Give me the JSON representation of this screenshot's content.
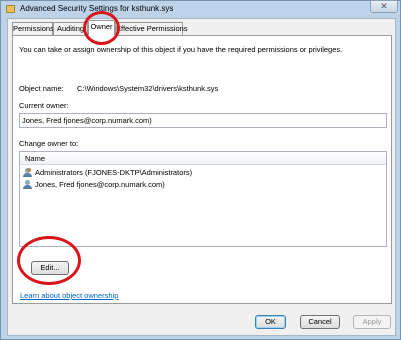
{
  "window": {
    "title": "Advanced Security Settings for ksthunk.sys",
    "close_glyph": "✕"
  },
  "tabs": [
    {
      "label": "Permissions"
    },
    {
      "label": "Auditing"
    },
    {
      "label": "Owner"
    },
    {
      "label": "Effective Permissions"
    }
  ],
  "owner_tab": {
    "intro": "You can take or assign ownership of this object if you have the required permissions or privileges.",
    "object_name_label": "Object name:",
    "object_name_value": "C:\\Windows\\System32\\drivers\\ksthunk.sys",
    "current_owner_label": "Current owner:",
    "current_owner_value": "Jones, Fred fjones@corp.numark.com)",
    "change_owner_label": "Change owner to:",
    "list_header": "Name",
    "owners": [
      {
        "name": "Administrators (FJONES-DKTP\\Administrators)",
        "icon": "group-icon"
      },
      {
        "name": "Jones, Fred fjones@corp.numark.com)",
        "icon": "user-icon"
      }
    ],
    "edit_button": "Edit...",
    "learn_link": "Learn about object ownership"
  },
  "footer": {
    "ok": "OK",
    "cancel": "Cancel",
    "apply": "Apply"
  },
  "colors": {
    "annotation": "#d9141a",
    "link": "#0066cc",
    "frame": "#bcd3ea"
  }
}
